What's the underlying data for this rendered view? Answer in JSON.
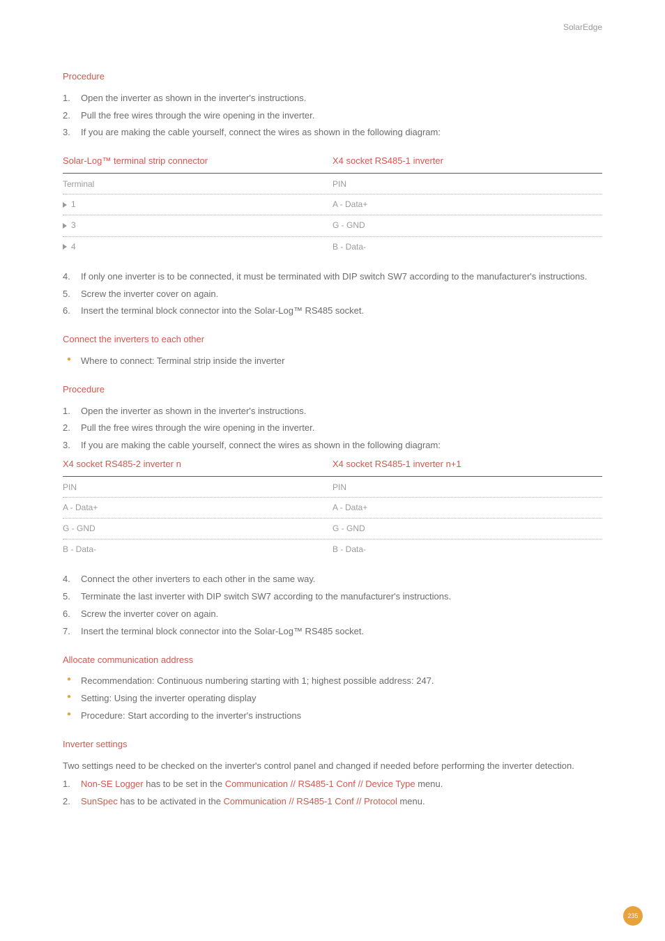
{
  "brand": "SolarEdge",
  "page_number": "235",
  "s1": {
    "title": "Procedure",
    "items": [
      "Open the inverter as shown in the inverter's instructions.",
      "Pull the free wires through the wire opening in the inverter.",
      "If you are making the cable yourself, connect the wires as shown in the following diagram:"
    ]
  },
  "table1": {
    "head1": "Solar-Log™ terminal strip connector",
    "head2": "X4 socket RS485-1 inverter",
    "sub1": "Terminal",
    "sub2": "PIN",
    "rows": [
      {
        "a": "1",
        "b": "A - Data+"
      },
      {
        "a": "3",
        "b": "G  - GND"
      },
      {
        "a": "4",
        "b": "B - Data-"
      }
    ]
  },
  "s1b": {
    "start": 4,
    "items": [
      "If only one inverter is to be connected, it must be terminated with DIP switch SW7 according to the manufacturer's instructions.",
      "Screw the inverter cover on again.",
      "Insert the terminal block connector into the Solar-Log™ RS485 socket."
    ]
  },
  "s2": {
    "title": "Connect the inverters to each other",
    "bullets": [
      "Where to connect: Terminal strip inside the inverter"
    ]
  },
  "s3": {
    "title": "Procedure",
    "items": [
      "Open the inverter as shown in the inverter's instructions.",
      "Pull the free wires through the wire opening in the inverter.",
      "If you are making the cable yourself, connect the wires as shown in the following diagram:"
    ]
  },
  "table2": {
    "head1": "X4 socket RS485-2 inverter n",
    "head2": "X4 socket RS485-1 inverter n+1",
    "sub1": "PIN",
    "sub2": "PIN",
    "rows": [
      {
        "a": "A - Data+",
        "b": "A - Data+"
      },
      {
        "a": "G  - GND",
        "b": "G  - GND"
      },
      {
        "a": "B - Data-",
        "b": "B - Data-"
      }
    ]
  },
  "s3b": {
    "start": 4,
    "items": [
      "Connect the other inverters to each other in the same way.",
      "Terminate the last inverter with DIP switch SW7 according to the manufacturer's instructions.",
      "Screw the inverter cover on again.",
      "Insert the terminal block connector into the Solar-Log™ RS485 socket."
    ]
  },
  "s4": {
    "title": "Allocate communication address",
    "bullets": [
      "Recommendation: Continuous numbering starting with 1; highest possible address: 247.",
      "Setting: Using the inverter operating display",
      "Procedure: Start according to the inverter's instructions"
    ]
  },
  "s5": {
    "title": "Inverter settings",
    "intro": "Two settings need to be checked on the inverter's control panel and changed if needed before performing the inverter detection.",
    "i1": {
      "a": "Non-SE Logger",
      "b": " has to be set in the  ",
      "c": "Communication // RS485-1 Conf // Device Type",
      "d": "  menu."
    },
    "i2": {
      "a": "SunSpec",
      "b": "  has to be activated in the ",
      "c": "Communication // RS485-1 Conf // Protocol",
      "d": " menu."
    }
  }
}
